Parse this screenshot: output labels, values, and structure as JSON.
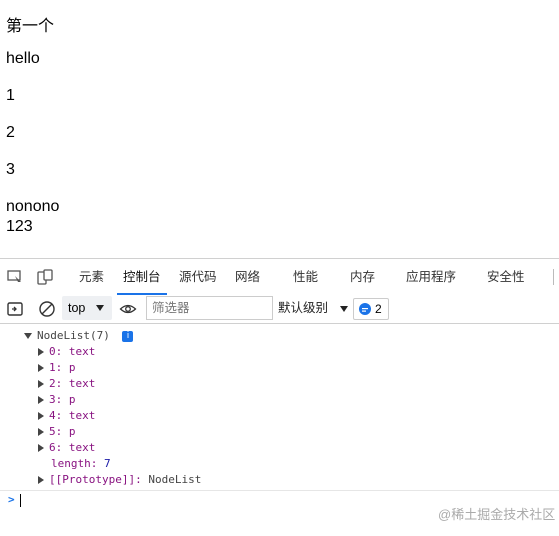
{
  "page": {
    "lines": [
      "第一个",
      "hello",
      "1",
      "2",
      "3",
      "nonono",
      "123"
    ]
  },
  "devtools": {
    "tabs": [
      "元素",
      "控制台",
      "源代码",
      "网络",
      "性能",
      "内存",
      "应用程序",
      "安全性"
    ],
    "active_tab": "控制台",
    "toolbar": {
      "context": "top",
      "filter_placeholder": "筛选器",
      "levels": "默认级别",
      "message_count": "2"
    },
    "console": {
      "nodelist_header": "NodeList(7)",
      "items": [
        {
          "index": "0:",
          "value": "text"
        },
        {
          "index": "1:",
          "value": "p"
        },
        {
          "index": "2:",
          "value": "text"
        },
        {
          "index": "3:",
          "value": "p"
        },
        {
          "index": "4:",
          "value": "text"
        },
        {
          "index": "5:",
          "value": "p"
        },
        {
          "index": "6:",
          "value": "text"
        }
      ],
      "length_key": "length:",
      "length_value": "7",
      "prototype_key": "[[Prototype]]:",
      "prototype_value": "NodeList",
      "prompt": ">"
    }
  },
  "watermark": "@稀土掘金技术社区",
  "colors": {
    "accent": "#1a73e8",
    "key": "#881280"
  }
}
